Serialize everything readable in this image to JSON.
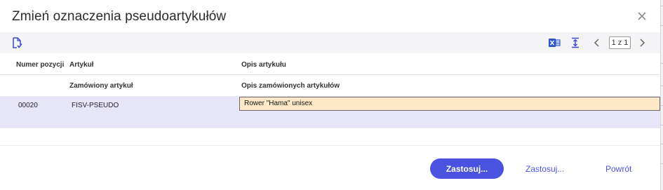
{
  "dialog": {
    "title": "Zmień oznaczenia pseudoartykułów",
    "close_icon": "close-icon"
  },
  "toolbar": {
    "document_check_icon": "document-check-icon",
    "excel_export_icon": "excel-export-icon",
    "fit_height_icon": "fit-height-icon",
    "prev_icon": "chevron-left-icon",
    "next_icon": "chevron-right-icon",
    "page_indicator": "1 z 1"
  },
  "table": {
    "headers_row1": {
      "item_number": "Numer pozycji",
      "article": "Artykuł",
      "article_description": "Opis artykułu"
    },
    "headers_row2": {
      "ordered_article": "Zamówiony artykuł",
      "ordered_articles_description": "Opis zamówionych artykułów"
    },
    "rows": [
      {
        "item_number": "00020",
        "ordered_article": "FISV-PSEUDO",
        "ordered_description": "Rower \"Hama\" unisex"
      }
    ]
  },
  "footer": {
    "apply_primary": "Zastosuj...",
    "apply_secondary": "Zastosuj...",
    "back": "Powrót"
  },
  "colors": {
    "accent": "#4a52e0",
    "row_highlight": "#e6e6f8",
    "input_highlight": "#ffe8c8",
    "excel_green": "#1d6fd0"
  }
}
